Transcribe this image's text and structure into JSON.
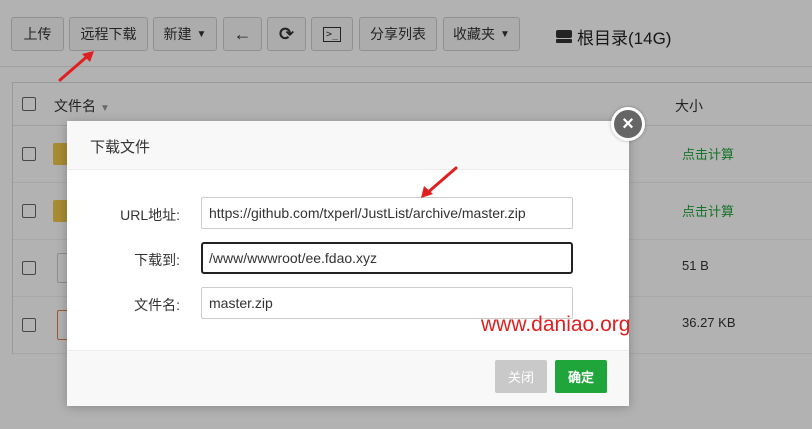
{
  "toolbar": {
    "upload": "上传",
    "remote_download": "远程下载",
    "new": "新建",
    "back_icon": "←",
    "refresh_icon": "⟳",
    "terminal_icon": ">_",
    "share_list": "分享列表",
    "favorites": "收藏夹",
    "path": "根目录(14G)"
  },
  "table": {
    "col_name": "文件名",
    "col_size": "大小",
    "rows": [
      {
        "type": "folder",
        "size": "点击计算"
      },
      {
        "type": "folder",
        "size": "点击计算"
      },
      {
        "type": "file",
        "size": "51 B"
      },
      {
        "type": "file",
        "size": "36.27 KB"
      }
    ]
  },
  "dialog": {
    "title": "下载文件",
    "url_label": "URL地址:",
    "url_value": "https://github.com/txperl/JustList/archive/master.zip",
    "dest_label": "下载到:",
    "dest_value": "/www/wwwroot/ee.fdao.xyz",
    "name_label": "文件名:",
    "name_value": "master.zip",
    "close_label": "关闭",
    "ok_label": "确定"
  },
  "watermark": "www.daniao.org",
  "colors": {
    "green": "#20a53a",
    "red_annotation": "#e02020"
  }
}
